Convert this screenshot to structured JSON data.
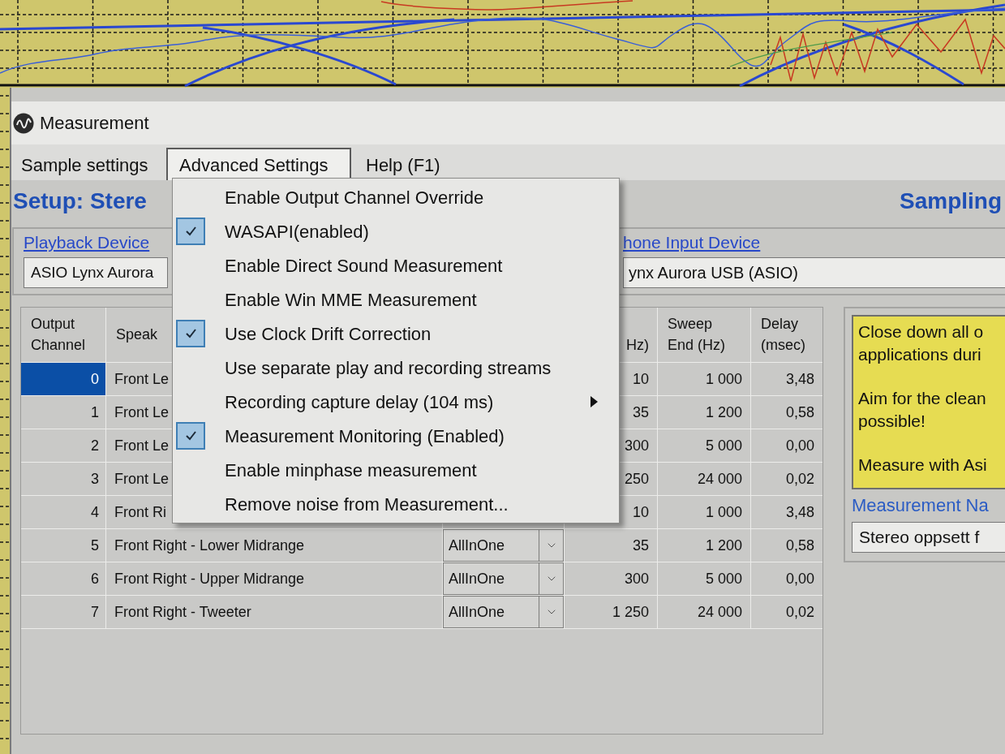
{
  "window": {
    "title": "Measurement"
  },
  "menubar": [
    {
      "label": "Sample settings",
      "selected": false
    },
    {
      "label": "Advanced Settings",
      "selected": true
    },
    {
      "label": "Help (F1)",
      "selected": false
    }
  ],
  "menu": {
    "items": [
      {
        "kind": "check",
        "label": "Enable Output Channel Override",
        "checked": false
      },
      {
        "kind": "check",
        "label": "WASAPI(enabled)",
        "checked": true
      },
      {
        "kind": "check",
        "label": "Enable Direct Sound Measurement",
        "checked": false
      },
      {
        "kind": "check",
        "label": "Enable Win MME Measurement",
        "checked": false
      },
      {
        "kind": "check",
        "label": "Use Clock Drift Correction",
        "checked": true
      },
      {
        "kind": "check",
        "label": "Use separate play and recording streams",
        "checked": false
      },
      {
        "kind": "submenu",
        "label": "Recording capture delay (104 ms)"
      },
      {
        "kind": "check",
        "label": "Measurement Monitoring (Enabled)",
        "checked": true
      },
      {
        "kind": "check",
        "label": "Enable minphase measurement",
        "checked": false
      },
      {
        "kind": "check",
        "label": "Remove noise from Measurement...",
        "checked": false
      }
    ]
  },
  "header": {
    "title": "Setup: Stere",
    "sampling": "Sampling"
  },
  "devices": {
    "playback": {
      "label": "Playback Device",
      "value": "ASIO Lynx Aurora"
    },
    "input": {
      "label": "hone Input Device",
      "value": "ynx Aurora USB (ASIO)"
    }
  },
  "table": {
    "columns": {
      "channel": "Output Channel",
      "speaker": "Speak",
      "sweep_start": "Hz)",
      "sweep_end": "Sweep End (Hz)",
      "delay": "Delay (msec)"
    },
    "rows": [
      {
        "channel": "0",
        "speaker": "Front Le",
        "sweep_start": "10",
        "sweep_end": "1 000",
        "delay": "3,48",
        "selected": true
      },
      {
        "channel": "1",
        "speaker": "Front Le",
        "sweep_start": "35",
        "sweep_end": "1 200",
        "delay": "0,58",
        "selected": false
      },
      {
        "channel": "2",
        "speaker": "Front Le",
        "sweep_start": "300",
        "sweep_end": "5 000",
        "delay": "0,00",
        "selected": false
      },
      {
        "channel": "3",
        "speaker": "Front Le",
        "sweep_start": "250",
        "sweep_end": "24 000",
        "delay": "0,02",
        "selected": false
      },
      {
        "channel": "4",
        "speaker": "Front Ri",
        "sweep_start": "10",
        "sweep_end": "1 000",
        "delay": "3,48",
        "selected": false
      },
      {
        "channel": "5",
        "speaker": "Front Right - Lower Midrange",
        "type": "AllInOne",
        "sweep_start": "35",
        "sweep_end": "1 200",
        "delay": "0,58",
        "selected": false
      },
      {
        "channel": "6",
        "speaker": "Front Right - Upper Midrange",
        "type": "AllInOne",
        "sweep_start": "300",
        "sweep_end": "5 000",
        "delay": "0,00",
        "selected": false
      },
      {
        "channel": "7",
        "speaker": "Front Right - Tweeter",
        "type": "AllInOne",
        "sweep_start": "1 250",
        "sweep_end": "24 000",
        "delay": "0,02",
        "selected": false
      }
    ]
  },
  "note": {
    "paragraphs": [
      [
        "Close down all o",
        "applications duri"
      ],
      [
        "Aim for the clean",
        "possible!"
      ],
      [
        "Measure with Asi"
      ]
    ]
  },
  "measurement_name": {
    "label": "Measurement Na",
    "value": "Stereo oppsett f"
  }
}
